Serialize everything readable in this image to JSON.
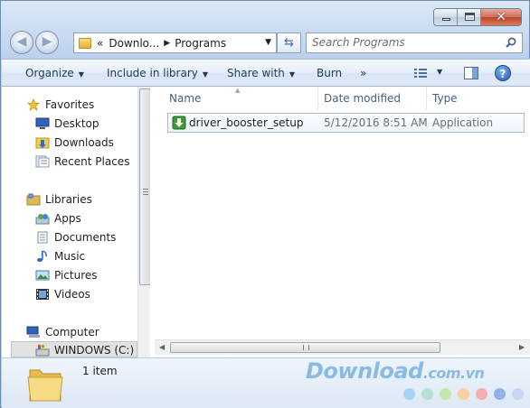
{
  "window": {
    "caption_buttons": [
      "minimize",
      "maximize",
      "close"
    ],
    "close_glyph": "✕"
  },
  "navigation": {
    "back_glyph": "◀",
    "forward_glyph": "▶",
    "recent_glyph": "▾"
  },
  "address": {
    "overflow": "«",
    "crumb1": "Downlo...",
    "crumb2": "Programs",
    "sep": "▶",
    "drop": "▼",
    "refresh_glyph": "⇆"
  },
  "search": {
    "placeholder": "Search Programs"
  },
  "toolbar": {
    "organize": "Organize",
    "include": "Include in library",
    "share": "Share with",
    "burn": "Burn",
    "more": "»",
    "drop_arrow": "▼",
    "help": "?"
  },
  "sidebar": {
    "favorites": "Favorites",
    "desktop": "Desktop",
    "downloads": "Downloads",
    "recent_places": "Recent Places",
    "libraries": "Libraries",
    "apps": "Apps",
    "documents": "Documents",
    "music": "Music",
    "pictures": "Pictures",
    "videos": "Videos",
    "computer": "Computer",
    "drive_c": "WINDOWS (C:)"
  },
  "columns": {
    "name": "Name",
    "date_modified": "Date modified",
    "type": "Type",
    "sort_glyph": "▲"
  },
  "files": [
    {
      "name": "driver_booster_setup",
      "date": "5/12/2016 8:51 AM",
      "type": "Application"
    }
  ],
  "details": {
    "count": "1 item"
  },
  "watermark": {
    "brand": "Download",
    "domain": ".com.vn",
    "dot_colors": [
      "#a6d3f2",
      "#b4e0d6",
      "#c6e6b0",
      "#f6d39e",
      "#f4aeb0",
      "#8fb4e4",
      "#c7d7f2"
    ]
  },
  "colors": {
    "accent": "#3568a8",
    "window_frame": "#bcd2ec"
  }
}
